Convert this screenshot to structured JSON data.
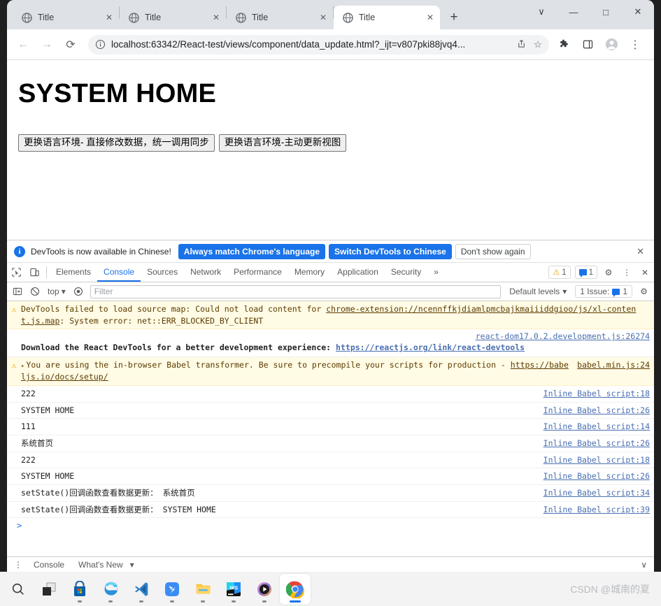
{
  "browser": {
    "tabs": [
      {
        "label": "Title",
        "active": false
      },
      {
        "label": "Title",
        "active": false
      },
      {
        "label": "Title",
        "active": false
      },
      {
        "label": "Title",
        "active": true
      }
    ],
    "new_tab_label": "+",
    "window_controls": {
      "tab_search": "∨",
      "minimize": "—",
      "maximize": "□",
      "close": "✕"
    },
    "toolbar": {
      "back": "←",
      "forward": "→",
      "reload": "⟳",
      "url": "localhost:63342/React-test/views/component/data_update.html?_ijt=v807pki88jvq4...",
      "site_info_icon": "ⓘ",
      "share_icon": "share-icon",
      "bookmark_icon": "☆",
      "extensions_icon": "puzzle-icon",
      "sidepanel_icon": "❑",
      "profile_icon": "avatar-icon",
      "menu_icon": "⋮"
    }
  },
  "page": {
    "title": "SYSTEM HOME",
    "buttons": [
      "更换语言环境- 直接修改数据，统一调用同步",
      "更换语言环境-主动更新视图"
    ]
  },
  "devtools": {
    "banner": {
      "message": "DevTools is now available in Chinese!",
      "primary_button": "Always match Chrome's language",
      "secondary_button": "Switch DevTools to Chinese",
      "dismiss_button": "Don't show again",
      "close": "✕"
    },
    "panels": [
      "Elements",
      "Console",
      "Sources",
      "Network",
      "Performance",
      "Memory",
      "Application",
      "Security"
    ],
    "panels_overflow": "»",
    "active_panel": "Console",
    "status": {
      "warning_count": "1",
      "message_count": "1"
    },
    "settings_icon": "⚙",
    "more_icon": "⋮",
    "close_icon": "✕",
    "console_toolbar": {
      "sidebar_toggle": "console-sidebar-icon",
      "clear_icon": "⃠",
      "context": "top",
      "context_caret": "▾",
      "live_expression_icon": "◉",
      "filter_placeholder": "Filter",
      "levels_label": "Default levels",
      "levels_caret": "▾",
      "issues_label": "1 Issue:",
      "issues_count": "1",
      "settings_icon": "⚙"
    },
    "messages": [
      {
        "kind": "warning",
        "text_before": "DevTools failed to load source map: Could not load content for ",
        "link": "chrome-extension://ncennffkjdiamlpmcbajkmaiiiddgioo/js/xl-content.js.map",
        "text_after": ": System error: net::ERR_BLOCKED_BY_CLIENT",
        "source": ""
      },
      {
        "kind": "react-devtools",
        "source": "react-dom17.0.2.development.js:26274",
        "text_before": "Download the React DevTools for a better development experience: ",
        "link": "https://reactjs.org/link/react-devtools"
      },
      {
        "kind": "warning-collapsible",
        "disclosure": "▸",
        "text_before": "You are using the in-browser Babel transformer. Be sure to precompile your scripts for production - ",
        "link": "https://babeljs.io/docs/setup/",
        "source": "babel.min.js:24"
      },
      {
        "kind": "log",
        "text": "222",
        "source": "Inline Babel script:18"
      },
      {
        "kind": "log",
        "text": "SYSTEM HOME",
        "source": "Inline Babel script:26"
      },
      {
        "kind": "log",
        "text": "111",
        "source": "Inline Babel script:14"
      },
      {
        "kind": "log",
        "text": "系统首页",
        "source": "Inline Babel script:26"
      },
      {
        "kind": "log",
        "text": "222",
        "source": "Inline Babel script:18"
      },
      {
        "kind": "log",
        "text": "SYSTEM HOME",
        "source": "Inline Babel script:26"
      },
      {
        "kind": "log",
        "text": "setState()回调函数查看数据更新： 系统首页",
        "source": "Inline Babel script:34"
      },
      {
        "kind": "log",
        "text": "setState()回调函数查看数据更新： SYSTEM HOME",
        "source": "Inline Babel script:39"
      }
    ],
    "prompt": ">",
    "drawer": {
      "more_icon": "⋮",
      "tabs": [
        "Console",
        "What's New"
      ],
      "caret": "▾",
      "collapse": "∨"
    }
  },
  "taskbar": {
    "items": [
      {
        "name": "search-icon"
      },
      {
        "name": "task-view-icon"
      },
      {
        "name": "microsoft-store-icon"
      },
      {
        "name": "edge-icon"
      },
      {
        "name": "vscode-icon"
      },
      {
        "name": "dingtalk-icon"
      },
      {
        "name": "file-explorer-icon"
      },
      {
        "name": "webstorm-icon"
      },
      {
        "name": "media-player-icon"
      },
      {
        "name": "chrome-icon"
      }
    ],
    "watermark": "CSDN @城南的夏"
  },
  "colors": {
    "accent": "#1a73e8",
    "warning_bg": "#fffbe5",
    "warning_glyph": "#e5a50a",
    "tabstrip_bg": "#dee1e6"
  }
}
